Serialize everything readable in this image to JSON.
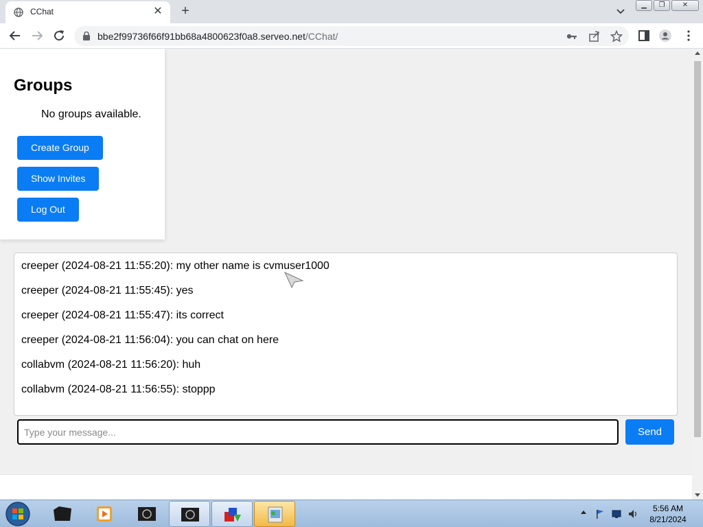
{
  "browser": {
    "tab_title": "CChat",
    "url_host": "bbe2f99736f66f91bb68a4800623f0a8.serveo.net",
    "url_path": "/CChat/"
  },
  "groups": {
    "title": "Groups",
    "empty_text": "No groups available.",
    "create_label": "Create Group",
    "invites_label": "Show Invites",
    "logout_label": "Log Out"
  },
  "chat": {
    "messages": [
      {
        "text": "creeper (2024-08-21 11:55:20): my other name is cvmuser1000"
      },
      {
        "text": "creeper (2024-08-21 11:55:45): yes"
      },
      {
        "text": "creeper (2024-08-21 11:55:47): its correct"
      },
      {
        "text": "creeper (2024-08-21 11:56:04): you can chat on here"
      },
      {
        "text": "collabvm (2024-08-21 11:56:20): huh"
      },
      {
        "text": "collabvm (2024-08-21 11:56:55): stoppp"
      }
    ],
    "input_placeholder": "Type your message...",
    "send_label": "Send"
  },
  "taskbar": {
    "time": "5:56 AM",
    "date": "8/21/2024"
  },
  "colors": {
    "accent": "#0a7cf4"
  }
}
